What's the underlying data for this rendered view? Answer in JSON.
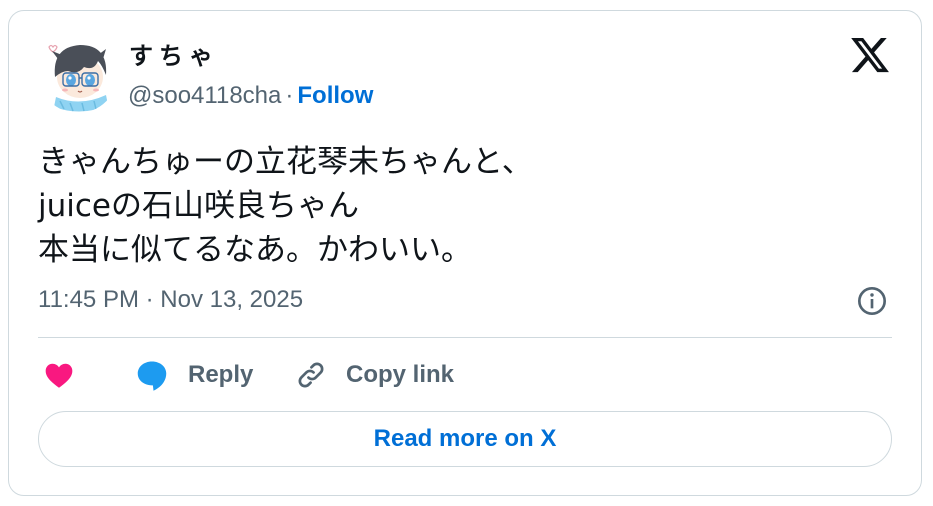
{
  "author": {
    "display_name": "すちゃ",
    "handle": "@soo4118cha",
    "separator": "·",
    "follow_label": "Follow",
    "avatar_icon": "anime-avatar-icon"
  },
  "platform_icon": "x-logo-icon",
  "tweet": {
    "lines": [
      "きゃんちゅーの立花琴未ちゃんと、",
      "juiceの石山咲良ちゃん",
      "本当に似てるなあ。かわいい。"
    ],
    "timestamp": "11:45 PM · Nov 13, 2025"
  },
  "actions": {
    "like_icon": "heart-icon",
    "reply_label": "Reply",
    "reply_icon": "speech-bubble-icon",
    "copy_label": "Copy link",
    "copy_icon": "link-icon"
  },
  "read_more_label": "Read more on X",
  "colors": {
    "accent_blue": "#006fd6",
    "like_pink": "#f91880",
    "reply_blue": "#1d9bf0",
    "secondary_text": "#536471",
    "border": "#cfd9de",
    "text": "#0f1419"
  }
}
